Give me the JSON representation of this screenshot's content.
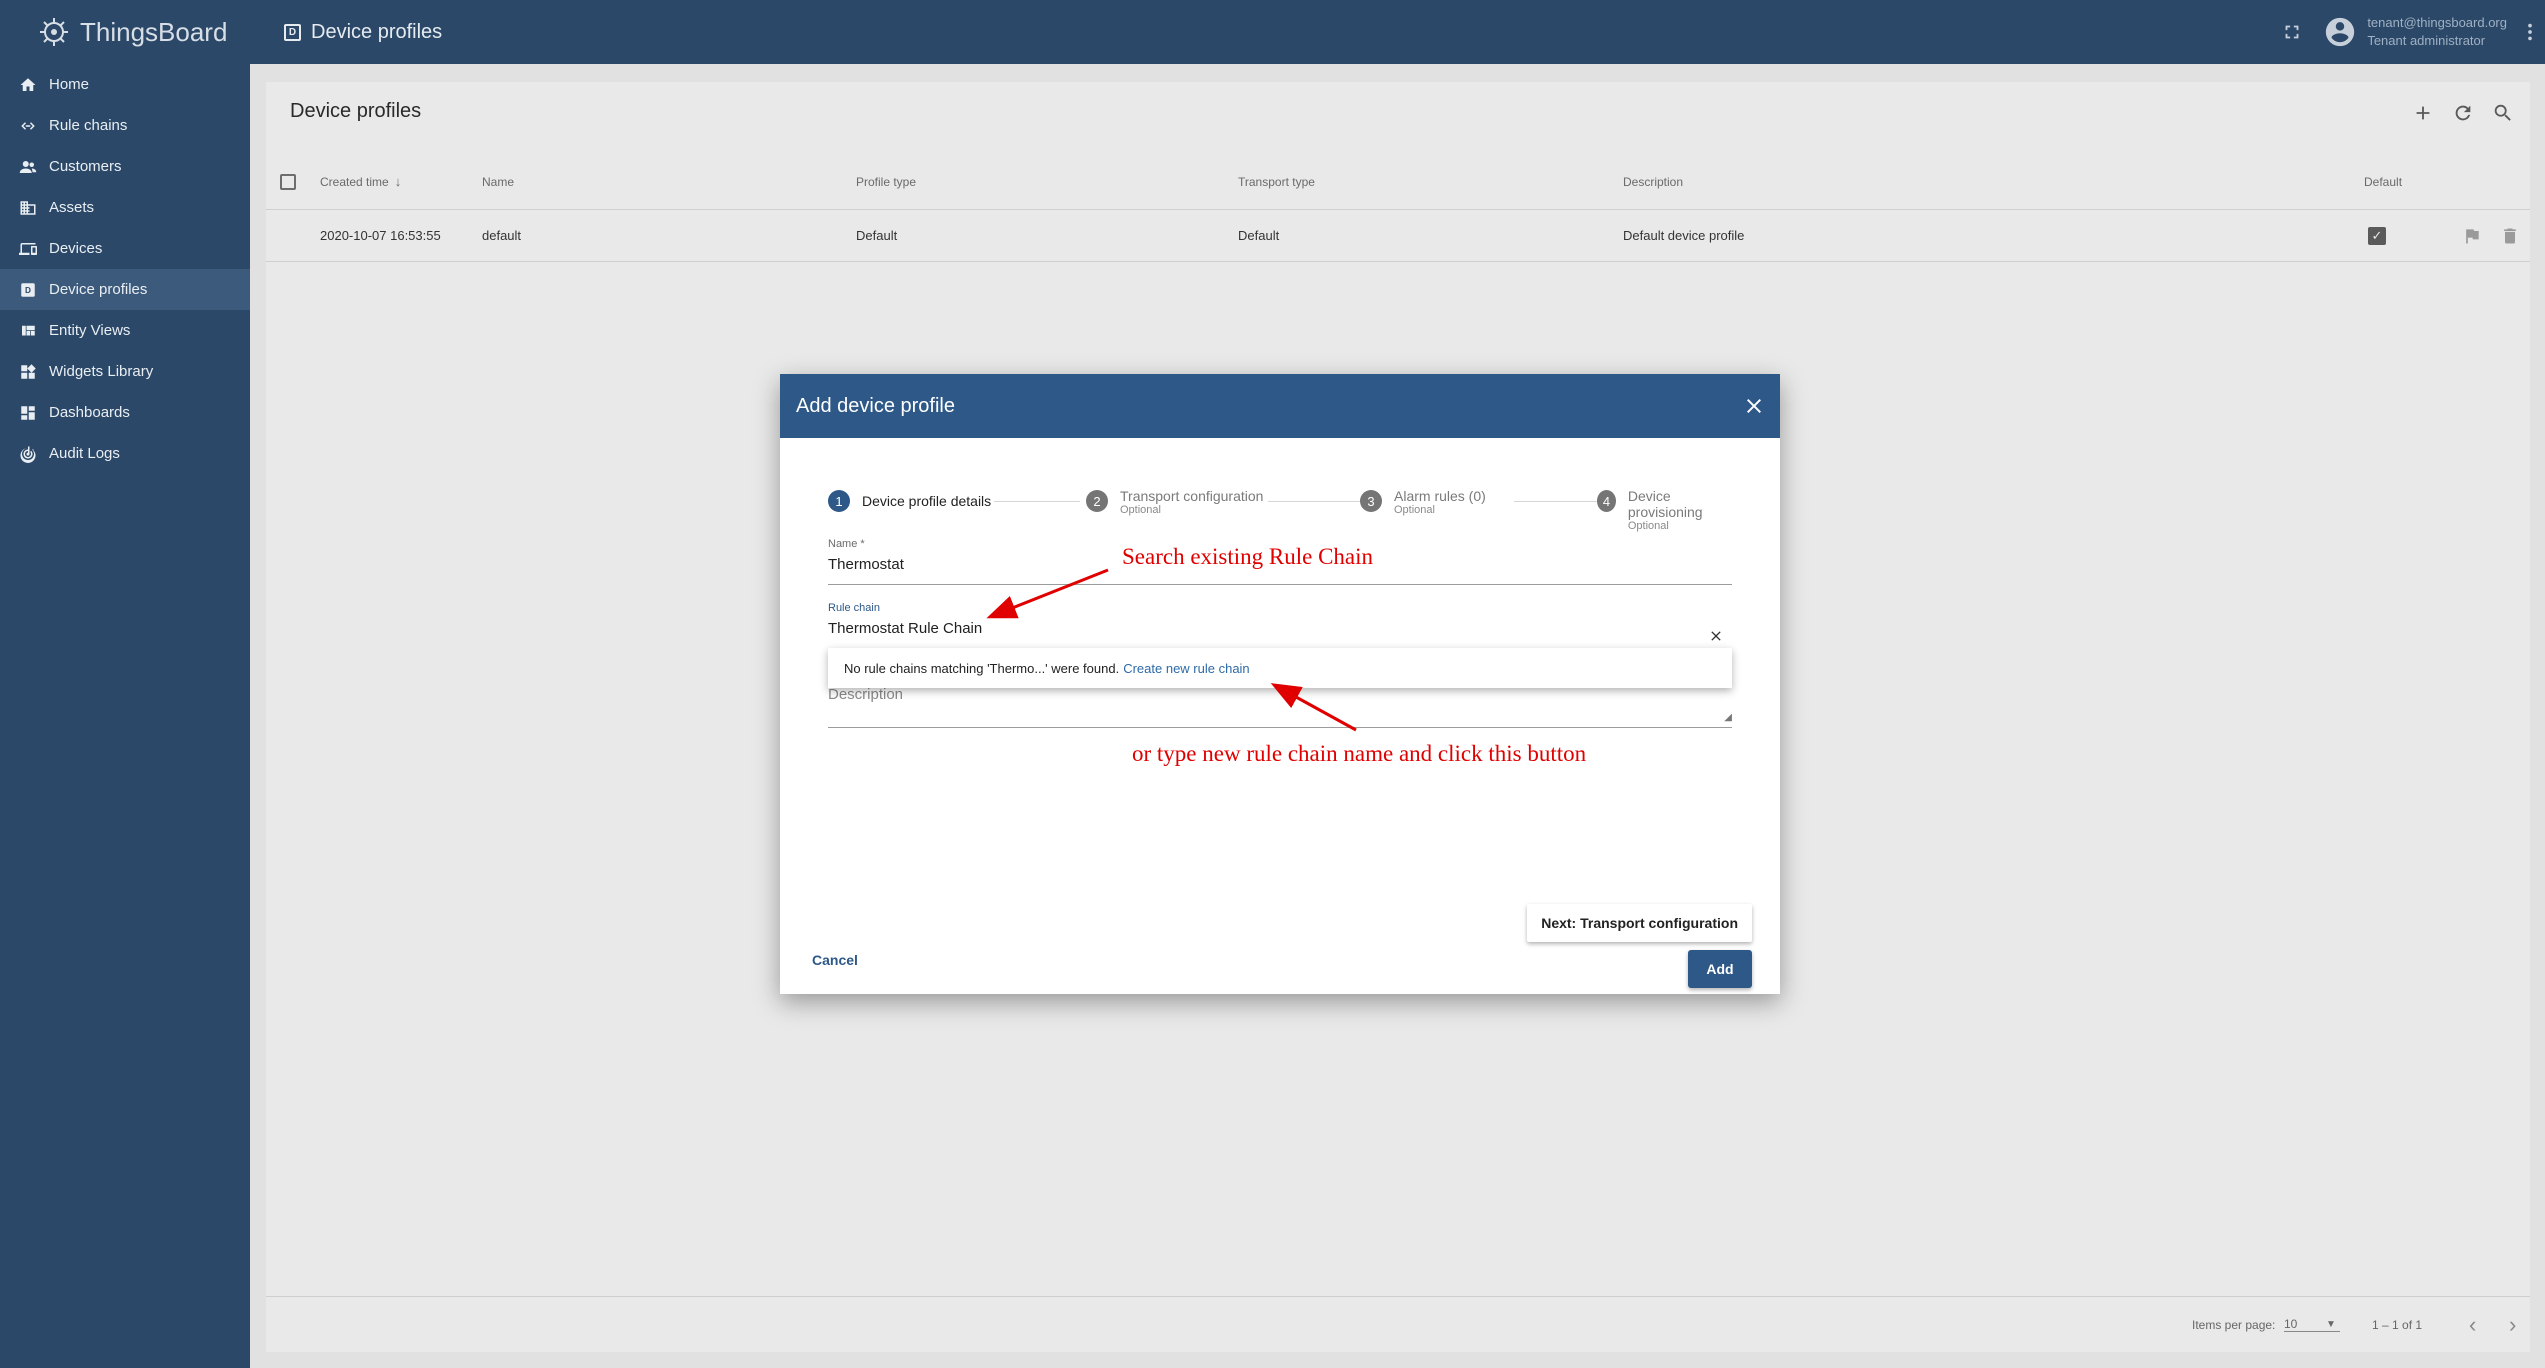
{
  "app": {
    "logo_text": "ThingsBoard"
  },
  "sidebar": {
    "items": [
      {
        "label": "Home",
        "icon": "home-icon"
      },
      {
        "label": "Rule chains",
        "icon": "code-arrows-icon"
      },
      {
        "label": "Customers",
        "icon": "people-icon"
      },
      {
        "label": "Assets",
        "icon": "domain-icon"
      },
      {
        "label": "Devices",
        "icon": "devices-icon"
      },
      {
        "label": "Device profiles",
        "icon": "device-profile-icon",
        "active": true
      },
      {
        "label": "Entity Views",
        "icon": "view-quilt-icon"
      },
      {
        "label": "Widgets Library",
        "icon": "widgets-icon"
      },
      {
        "label": "Dashboards",
        "icon": "dashboard-icon"
      },
      {
        "label": "Audit Logs",
        "icon": "track-changes-icon"
      }
    ]
  },
  "topbar": {
    "title": "Device profiles",
    "user_email": "tenant@thingsboard.org",
    "user_role": "Tenant administrator"
  },
  "card": {
    "title": "Device profiles",
    "columns": {
      "created_time": "Created time",
      "name": "Name",
      "profile_type": "Profile type",
      "transport_type": "Transport type",
      "description": "Description",
      "default": "Default"
    },
    "rows": [
      {
        "created_time": "2020-10-07 16:53:55",
        "name": "default",
        "profile_type": "Default",
        "transport_type": "Default",
        "description": "Default device profile",
        "default": true
      }
    ],
    "paginator": {
      "items_per_page_label": "Items per page:",
      "items_per_page": "10",
      "range": "1 – 1 of 1"
    }
  },
  "dialog": {
    "title": "Add device profile",
    "steps": [
      {
        "num": "1",
        "label": "Device profile details",
        "sub": ""
      },
      {
        "num": "2",
        "label": "Transport configuration",
        "sub": "Optional"
      },
      {
        "num": "3",
        "label": "Alarm rules (0)",
        "sub": "Optional"
      },
      {
        "num": "4",
        "label": "Device provisioning",
        "sub": "Optional"
      }
    ],
    "name_label": "Name *",
    "name_value": "Thermostat",
    "rule_chain_label": "Rule chain",
    "rule_chain_value": "Thermostat Rule Chain",
    "dropdown_text": "No rule chains matching 'Thermo...' were found.",
    "dropdown_link": "Create new rule chain",
    "description_placeholder": "Description",
    "next_button": "Next: Transport configuration",
    "cancel_button": "Cancel",
    "add_button": "Add"
  },
  "annotations": {
    "search": "Search existing Rule Chain",
    "create": "or type new rule chain name and click this button",
    "color": "#e00000"
  }
}
